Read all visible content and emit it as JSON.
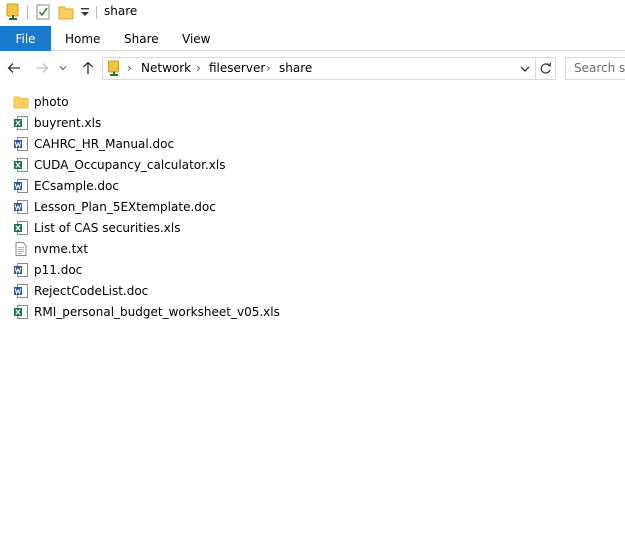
{
  "window": {
    "title": "share"
  },
  "ribbon": {
    "tabs": [
      {
        "label": "File",
        "active": true
      },
      {
        "label": "Home"
      },
      {
        "label": "Share"
      },
      {
        "label": "View"
      }
    ]
  },
  "address": {
    "breadcrumbs": [
      "Network",
      "fileserver",
      "share"
    ]
  },
  "search": {
    "placeholder": "Search share"
  },
  "colors": {
    "accent": "#1979ca",
    "folder": "#ffd05c",
    "excel": "#1e7145",
    "word": "#2b5797"
  },
  "files": [
    {
      "name": "photo",
      "icon": "folder-icon"
    },
    {
      "name": "buyrent.xls",
      "icon": "excel-file-icon"
    },
    {
      "name": "CAHRC_HR_Manual.doc",
      "icon": "word-file-icon"
    },
    {
      "name": "CUDA_Occupancy_calculator.xls",
      "icon": "excel-file-icon"
    },
    {
      "name": "ECsample.doc",
      "icon": "word-file-icon"
    },
    {
      "name": "Lesson_Plan_5EXtemplate.doc",
      "icon": "word-file-icon"
    },
    {
      "name": "List of CAS securities.xls",
      "icon": "excel-file-icon"
    },
    {
      "name": "nvme.txt",
      "icon": "text-file-icon"
    },
    {
      "name": "p11.doc",
      "icon": "word-file-icon"
    },
    {
      "name": "RejectCodeList.doc",
      "icon": "word-file-icon"
    },
    {
      "name": "RMI_personal_budget_worksheet_v05.xls",
      "icon": "excel-file-icon"
    }
  ]
}
